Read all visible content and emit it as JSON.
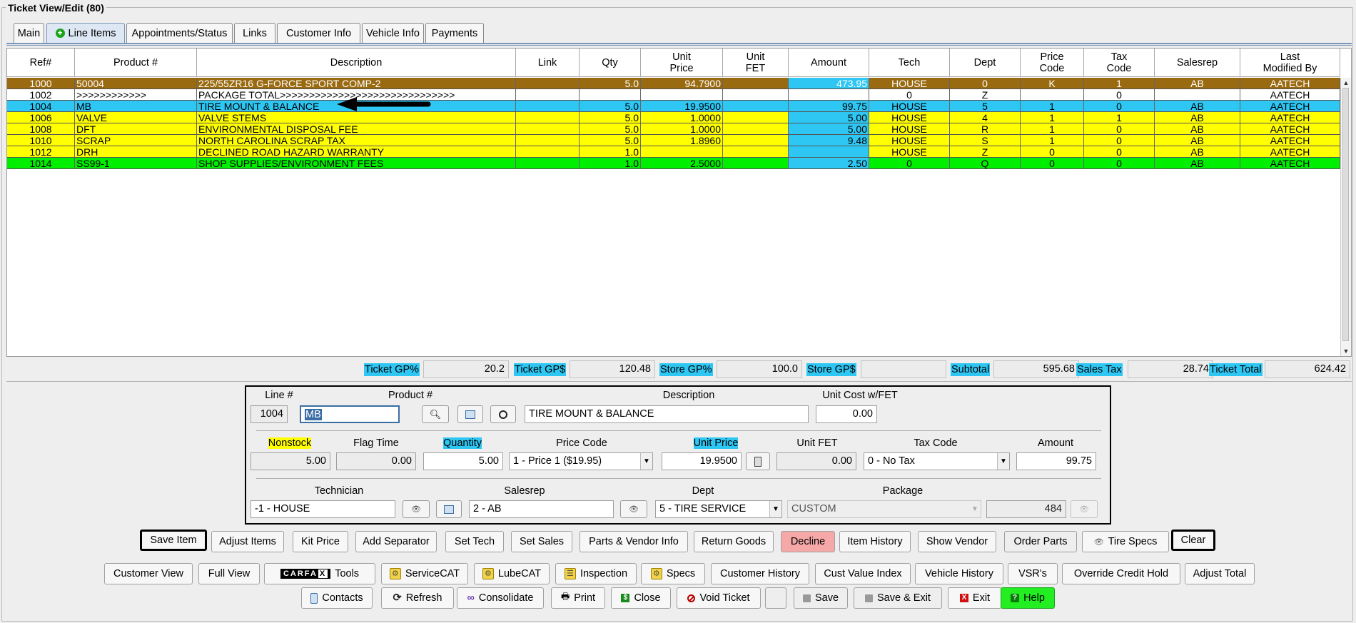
{
  "window": {
    "title": "Ticket View/Edit  (80)"
  },
  "tabs": [
    {
      "label": "Main"
    },
    {
      "label": "Line Items",
      "icon": "plus-circle-icon"
    },
    {
      "label": "Appointments/Status"
    },
    {
      "label": "Links"
    },
    {
      "label": "Customer Info"
    },
    {
      "label": "Vehicle Info"
    },
    {
      "label": "Payments"
    }
  ],
  "grid": {
    "columns": [
      "Ref#",
      "Product #",
      "Description",
      "Link",
      "Qty",
      "Unit\nPrice",
      "Unit\nFET",
      "Amount",
      "Tech",
      "Dept",
      "Price\nCode",
      "Tax\nCode",
      "Salesrep",
      "Last\nModified By"
    ],
    "rows": [
      {
        "ref": "1000",
        "product": "50004",
        "desc": "225/55ZR16  G-FORCE SPORT COMP-2",
        "link": "",
        "qty": "5.0",
        "unit_price": "94.7900",
        "fet": "",
        "amount": "473.95",
        "tech": "HOUSE",
        "dept": "0",
        "price_code": "K",
        "tax_code": "1",
        "salesrep": "AB",
        "modified": "AATECH",
        "style": "brown"
      },
      {
        "ref": "1002",
        "product": ">>>>>>>>>>>>",
        "desc": "PACKAGE TOTAL>>>>>>>>>>>>>>>>>>>>>>>>>>>>>>",
        "link": "",
        "qty": "",
        "unit_price": "",
        "fet": "",
        "amount": "",
        "tech": "0",
        "dept": "Z",
        "price_code": "",
        "tax_code": "0",
        "salesrep": "",
        "modified": "AATECH",
        "style": "white"
      },
      {
        "ref": "1004",
        "product": "MB",
        "desc": "TIRE MOUNT & BALANCE",
        "link": "",
        "qty": "5.0",
        "unit_price": "19.9500",
        "fet": "",
        "amount": "99.75",
        "tech": "HOUSE",
        "dept": "5",
        "price_code": "1",
        "tax_code": "0",
        "salesrep": "AB",
        "modified": "AATECH",
        "style": "cyan"
      },
      {
        "ref": "1006",
        "product": "VALVE",
        "desc": "VALVE STEMS",
        "link": "",
        "qty": "5.0",
        "unit_price": "1.0000",
        "fet": "",
        "amount": "5.00",
        "tech": "HOUSE",
        "dept": "4",
        "price_code": "1",
        "tax_code": "1",
        "salesrep": "AB",
        "modified": "AATECH",
        "style": "yellow"
      },
      {
        "ref": "1008",
        "product": "DFT",
        "desc": "ENVIRONMENTAL DISPOSAL FEE",
        "link": "",
        "qty": "5.0",
        "unit_price": "1.0000",
        "fet": "",
        "amount": "5.00",
        "tech": "HOUSE",
        "dept": "R",
        "price_code": "1",
        "tax_code": "0",
        "salesrep": "AB",
        "modified": "AATECH",
        "style": "yellow"
      },
      {
        "ref": "1010",
        "product": "SCRAP",
        "desc": "NORTH CAROLINA SCRAP TAX",
        "link": "",
        "qty": "5.0",
        "unit_price": "1.8960",
        "fet": "",
        "amount": "9.48",
        "tech": "HOUSE",
        "dept": "S",
        "price_code": "1",
        "tax_code": "0",
        "salesrep": "AB",
        "modified": "AATECH",
        "style": "yellow"
      },
      {
        "ref": "1012",
        "product": "DRH",
        "desc": "DECLINED ROAD HAZARD WARRANTY",
        "link": "",
        "qty": "1.0",
        "unit_price": "",
        "fet": "",
        "amount": "",
        "tech": "HOUSE",
        "dept": "Z",
        "price_code": "0",
        "tax_code": "0",
        "salesrep": "AB",
        "modified": "AATECH",
        "style": "yellow"
      },
      {
        "ref": "1014",
        "product": "SS99-1",
        "desc": "SHOP SUPPLIES/ENVIRONMENT FEES",
        "link": "",
        "qty": "1.0",
        "unit_price": "2.5000",
        "fet": "",
        "amount": "2.50",
        "tech": "0",
        "dept": "Q",
        "price_code": "0",
        "tax_code": "0",
        "salesrep": "AB",
        "modified": "AATECH",
        "style": "green"
      }
    ],
    "row_colors": {
      "brown": "#9a6a10",
      "white": "#ffffff",
      "cyan": "#2ec7f4",
      "yellow": "#ffff00",
      "green": "#00ee00",
      "amount_highlight": "#2ec7f4"
    }
  },
  "totals": [
    {
      "label": "Ticket GP%",
      "value": "20.2"
    },
    {
      "label": "Ticket GP$",
      "value": "120.48"
    },
    {
      "label": "Store GP%",
      "value": "100.0"
    },
    {
      "label": "Store GP$",
      "value": ""
    },
    {
      "label": "Subtotal",
      "value": "595.68"
    },
    {
      "label": "Sales Tax",
      "value": "28.74"
    },
    {
      "label": "Ticket Total",
      "value": "624.42"
    }
  ],
  "edit": {
    "line_label": "Line #",
    "line_value": "1004",
    "product_label": "Product #",
    "product_value": "MB",
    "description_label": "Description",
    "description_value": "TIRE MOUNT & BALANCE",
    "unit_cost_label": "Unit Cost w/FET",
    "unit_cost_value": "0.00",
    "nonstock_label": "Nonstock",
    "nonstock_value": "5.00",
    "flag_time_label": "Flag Time",
    "flag_time_value": "0.00",
    "quantity_label": "Quantity",
    "quantity_value": "5.00",
    "price_code_label": "Price Code",
    "price_code_value": "1 - Price 1 ($19.95)",
    "unit_price_label": "Unit Price",
    "unit_price_value": "19.9500",
    "unit_fet_label": "Unit FET",
    "unit_fet_value": "0.00",
    "tax_code_label": "Tax Code",
    "tax_code_value": "0 - No Tax",
    "amount_label": "Amount",
    "amount_value": "99.75",
    "technician_label": "Technician",
    "technician_value": "-1 -  HOUSE",
    "salesrep_label": "Salesrep",
    "salesrep_value": "2 - AB",
    "dept_label": "Dept",
    "dept_value": "5 - TIRE SERVICE",
    "package_label": "Package",
    "package_value": "CUSTOM",
    "package_number": "484"
  },
  "action_buttons": [
    "Save Item",
    "Adjust Items",
    "Kit Price",
    "Add Separator",
    "Set Tech",
    "Set Sales",
    "Parts & Vendor Info",
    "Return Goods",
    "Decline",
    "Item History",
    "Show Vendor",
    "Order Parts",
    "Tire Specs",
    "Clear"
  ],
  "nav_buttons": [
    "Customer View",
    "Full View",
    "Tools",
    "ServiceCAT",
    "LubeCAT",
    "Inspection",
    "Specs",
    "Customer History",
    "Cust Value Index",
    "Vehicle History",
    "VSR's",
    "Override Credit Hold",
    "Adjust Total"
  ],
  "bottom_buttons": [
    "Contacts",
    "Refresh",
    "Consolidate",
    "Print",
    "Close",
    "Void Ticket",
    "",
    "Save",
    "Save & Exit",
    "Exit",
    "Help"
  ],
  "carfax": {
    "text": "CARFAX"
  },
  "colors": {
    "decline_bg": "#f6a8a8",
    "help_bg": "#22ee22",
    "label_highlight_yellow": "#ffff00",
    "label_highlight_cyan": "#2ec7f4"
  }
}
